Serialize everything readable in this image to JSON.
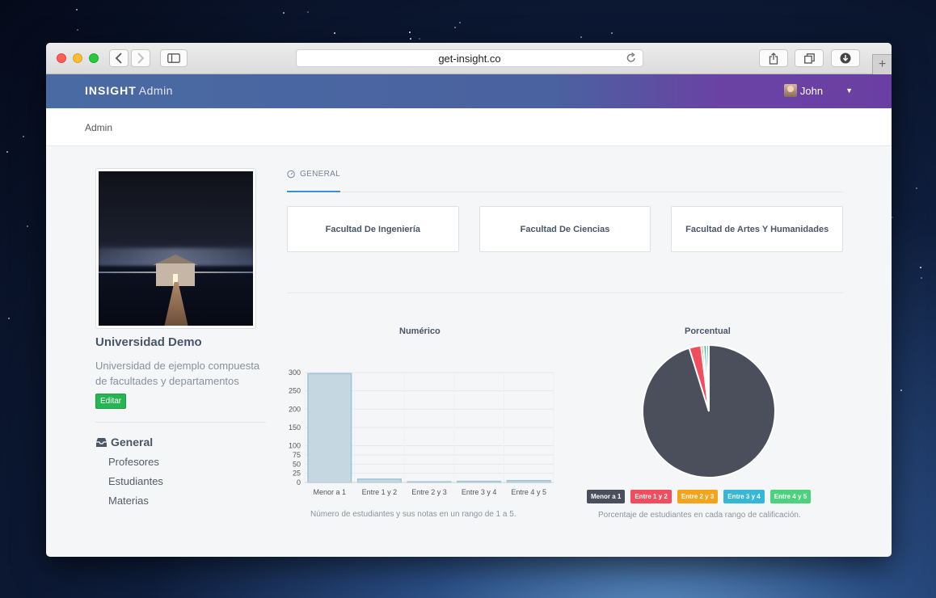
{
  "browser": {
    "url": "get-insight.co"
  },
  "navbar": {
    "brand_bold": "INSIGHT",
    "brand_light": "Admin",
    "user_name": "John"
  },
  "breadcrumb": "Admin",
  "profile": {
    "name": "Universidad Demo",
    "description": "Universidad de ejemplo compuesta de facultades y departamentos",
    "edit_label": "Editar"
  },
  "sidebar": {
    "heading": "General",
    "items": [
      {
        "label": "Profesores"
      },
      {
        "label": "Estudiantes"
      },
      {
        "label": "Materias"
      }
    ]
  },
  "tabs": [
    {
      "label": "GENERAL"
    }
  ],
  "faculties": [
    {
      "name": "Facultad De Ingeniería"
    },
    {
      "name": "Facultad De Ciencias"
    },
    {
      "name": "Facultad de Artes Y Humanidades"
    }
  ],
  "colors": {
    "bar_fill": "#c5d7e0",
    "bar_stroke": "#9ec3d6",
    "pie_main": "#4b4e5b",
    "red": "#f24d5e",
    "orange": "#f5a31a",
    "cyan": "#35b8d6",
    "green": "#4cd17c"
  },
  "chart_data": [
    {
      "type": "bar",
      "title": "Numérico",
      "categories": [
        "Menor a 1",
        "Entre 1 y 2",
        "Entre 2 y 3",
        "Entre 3 y 4",
        "Entre 4 y 5"
      ],
      "values": [
        297,
        9,
        2,
        3,
        5
      ],
      "ylim": [
        0,
        300
      ],
      "yticks": [
        0,
        25,
        50,
        75,
        100,
        150,
        200,
        250,
        300
      ],
      "caption": "Número de estudiantes y sus notas en un rango de 1 a 5.",
      "grid": true
    },
    {
      "type": "pie",
      "title": "Porcentual",
      "labels": [
        "Menor a 1",
        "Entre 1 y 2",
        "Entre 2 y 3",
        "Entre 3 y 4",
        "Entre 4 y 5"
      ],
      "values": [
        95.2,
        2.9,
        0.6,
        0.7,
        0.6
      ],
      "legend": "bottom",
      "caption": "Porcentaje de estudiantes en cada rango de calificación."
    }
  ]
}
